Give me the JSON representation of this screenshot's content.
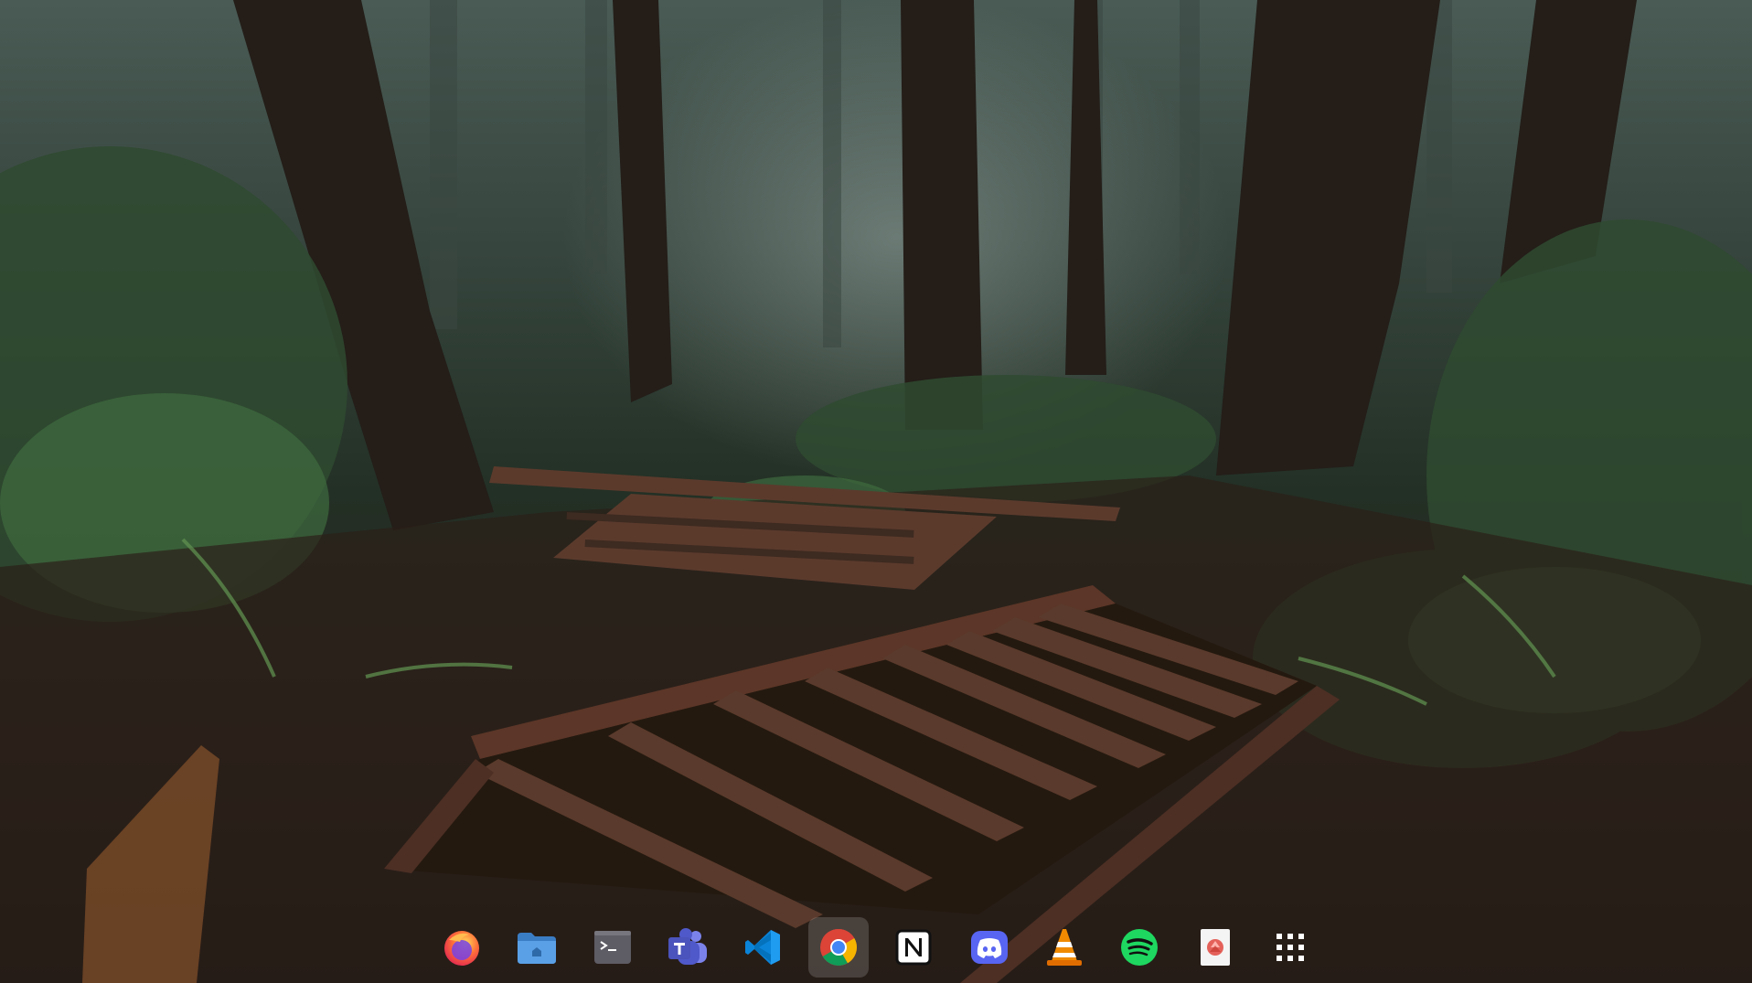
{
  "desktop": {
    "wallpaper": "forest-stairs-wallpaper"
  },
  "dock": {
    "active_item": "chrome",
    "items": [
      {
        "id": "firefox",
        "icon": "firefox-icon",
        "accent": "#ff7139"
      },
      {
        "id": "files",
        "icon": "folder-icon",
        "accent": "#4a90d9"
      },
      {
        "id": "terminal",
        "icon": "terminal-icon",
        "accent": "#5e5c64",
        "glyph": ">_"
      },
      {
        "id": "teams",
        "icon": "teams-icon",
        "accent": "#5b5fc7",
        "glyph": "T"
      },
      {
        "id": "vscode",
        "icon": "vscode-icon",
        "accent": "#0a84d9"
      },
      {
        "id": "chrome",
        "icon": "chrome-icon",
        "accent": "#4285f4"
      },
      {
        "id": "notion",
        "icon": "notion-icon",
        "accent": "#ffffff",
        "glyph": "N"
      },
      {
        "id": "discord",
        "icon": "discord-icon",
        "accent": "#5865f2"
      },
      {
        "id": "vlc",
        "icon": "vlc-icon",
        "accent": "#f08a00"
      },
      {
        "id": "spotify",
        "icon": "spotify-icon",
        "accent": "#1ed760"
      },
      {
        "id": "trash",
        "icon": "trash-icon",
        "accent": "#e0473e"
      },
      {
        "id": "app-grid",
        "icon": "app-grid-icon",
        "accent": "#ffffff"
      }
    ]
  }
}
